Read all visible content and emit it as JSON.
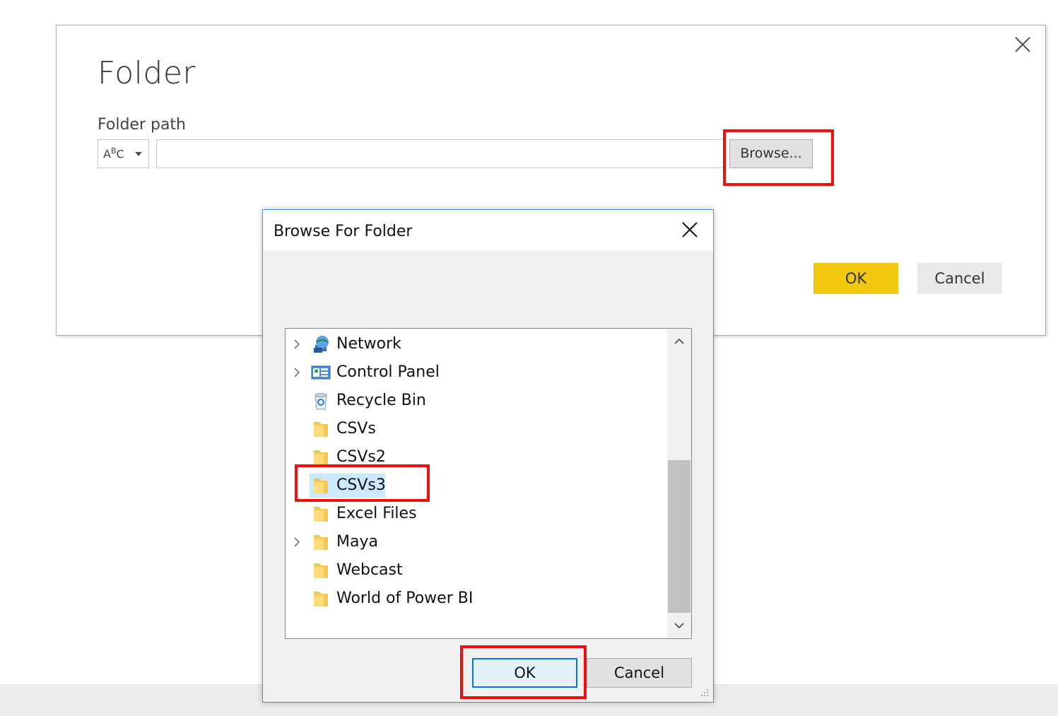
{
  "folder_dialog": {
    "title": "Folder",
    "path_label": "Folder path",
    "type_label": "ABC",
    "path_value": "",
    "browse_label": "Browse...",
    "ok_label": "OK",
    "cancel_label": "Cancel",
    "ok_color": "#f2c80f"
  },
  "browse_dialog": {
    "title": "Browse For Folder",
    "ok_label": "OK",
    "cancel_label": "Cancel",
    "tree": [
      {
        "label": "Network",
        "icon": "network-icon",
        "expandable": true
      },
      {
        "label": "Control Panel",
        "icon": "control-panel-icon",
        "expandable": true
      },
      {
        "label": "Recycle Bin",
        "icon": "recycle-bin-icon",
        "expandable": false
      },
      {
        "label": "CSVs",
        "icon": "folder-icon",
        "expandable": false
      },
      {
        "label": "CSVs2",
        "icon": "folder-icon",
        "expandable": false
      },
      {
        "label": "CSVs3",
        "icon": "folder-icon",
        "expandable": false,
        "selected": true
      },
      {
        "label": "Excel Files",
        "icon": "folder-icon",
        "expandable": false
      },
      {
        "label": "Maya",
        "icon": "folder-icon",
        "expandable": true
      },
      {
        "label": "Webcast",
        "icon": "folder-icon",
        "expandable": false
      },
      {
        "label": "World of Power BI",
        "icon": "folder-icon",
        "expandable": false
      }
    ]
  },
  "annotation_color": "#f00f0f"
}
